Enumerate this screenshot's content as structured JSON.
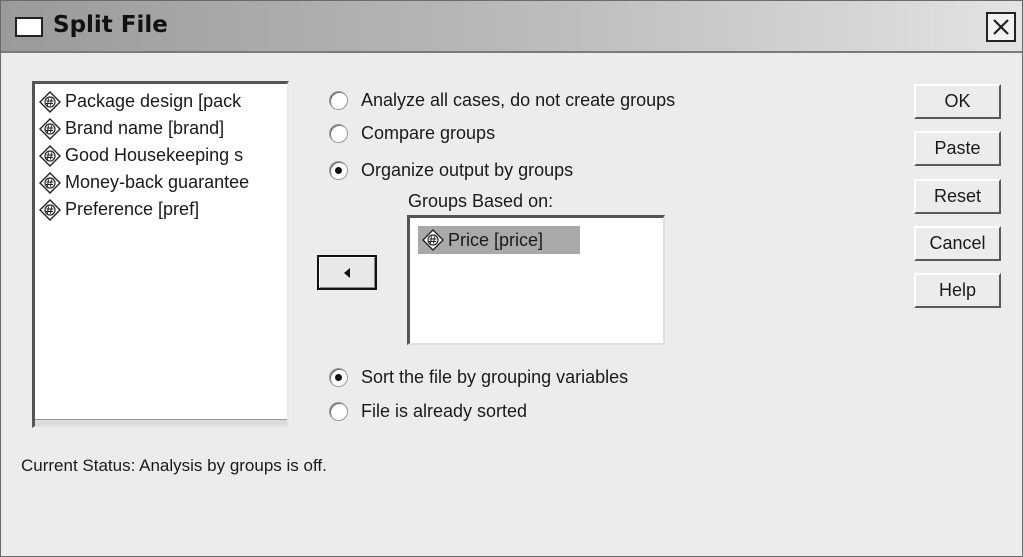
{
  "window": {
    "title": "Split File"
  },
  "variables": [
    {
      "label": "Package design [pack"
    },
    {
      "label": "Brand name [brand]"
    },
    {
      "label": "Good Housekeeping s"
    },
    {
      "label": "Money-back guarantee"
    },
    {
      "label": "Preference [pref]"
    }
  ],
  "grouping_options": {
    "analyze_all": "Analyze all cases, do not create groups",
    "compare": "Compare groups",
    "organize": "Organize output by groups",
    "selected": "organize"
  },
  "groups_based_on": {
    "label": "Groups Based on:",
    "items": [
      "Price [price]"
    ]
  },
  "sort_options": {
    "sort": "Sort the file by grouping variables",
    "already_sorted": "File is already sorted",
    "selected": "sort"
  },
  "buttons": {
    "ok": "OK",
    "paste": "Paste",
    "reset": "Reset",
    "cancel": "Cancel",
    "help": "Help"
  },
  "status": "Current Status:  Analysis by groups is off."
}
